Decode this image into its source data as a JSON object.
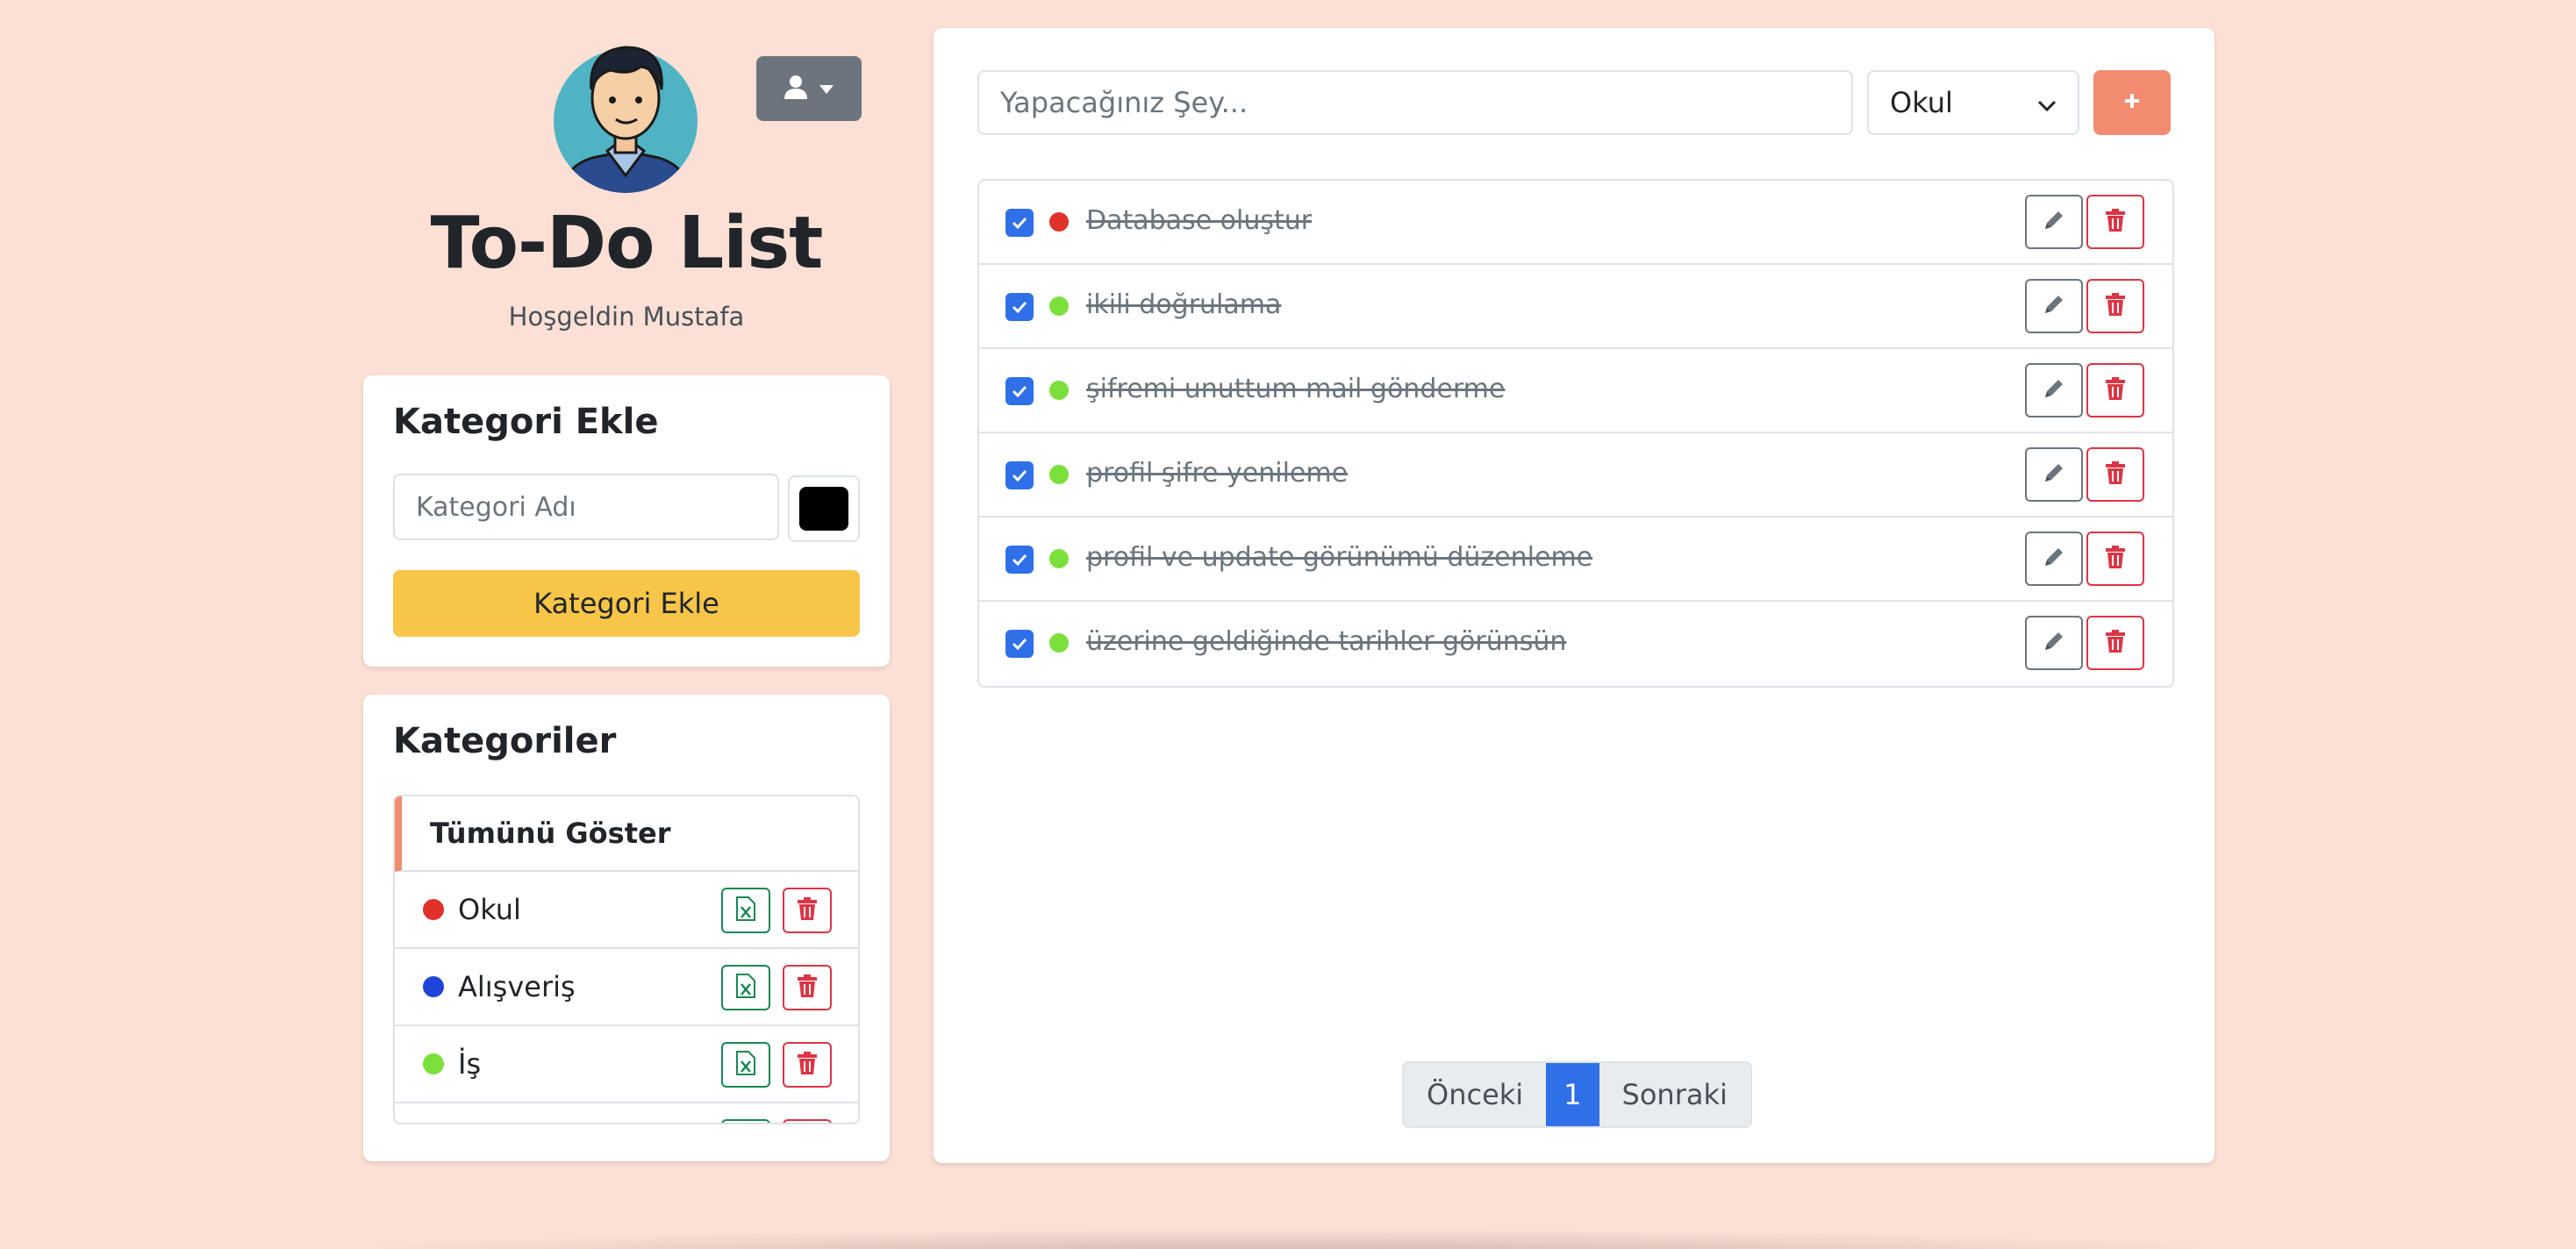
{
  "header": {
    "title": "To-Do List",
    "welcome": "Hoşgeldin Mustafa",
    "user_menu_icon": "user-icon"
  },
  "add_category": {
    "title": "Kategori Ekle",
    "input_placeholder": "Kategori Adı",
    "input_value": "",
    "color_value": "#000000",
    "button_label": "Kategori Ekle"
  },
  "categories": {
    "title": "Kategoriler",
    "show_all_label": "Tümünü Göster",
    "items": [
      {
        "name": "Okul",
        "color": "#e0312b"
      },
      {
        "name": "Alışveriş",
        "color": "#1f44d8"
      },
      {
        "name": "İş",
        "color": "#7ce03c"
      },
      {
        "name": "",
        "color": "#000000"
      }
    ]
  },
  "task_form": {
    "input_placeholder": "Yapacağınız Şey...",
    "input_value": "",
    "selected_category": "Okul",
    "add_button_icon": "plus-icon"
  },
  "tasks": [
    {
      "text": "Database oluştur",
      "done": true,
      "color": "#e0312b"
    },
    {
      "text": "ikili doğrulama",
      "done": true,
      "color": "#7ce03c"
    },
    {
      "text": "şifremi unuttum mail gönderme",
      "done": true,
      "color": "#7ce03c"
    },
    {
      "text": "profil şifre yenileme",
      "done": true,
      "color": "#7ce03c"
    },
    {
      "text": "profil ve update görünümü düzenleme",
      "done": true,
      "color": "#7ce03c"
    },
    {
      "text": "üzerine geldiğinde tarihler görünsün",
      "done": true,
      "color": "#7ce03c"
    }
  ],
  "pagination": {
    "prev_label": "Önceki",
    "current_page": "1",
    "next_label": "Sonraki"
  },
  "colors": {
    "background": "#fce0d6",
    "accent": "#f28b70",
    "primary": "#2f6fe8",
    "warning": "#f7c548",
    "danger": "#dc3545",
    "success": "#198754",
    "secondary": "#6c757d"
  }
}
